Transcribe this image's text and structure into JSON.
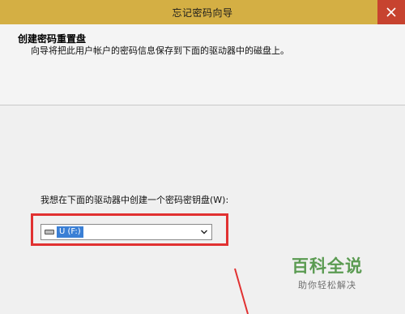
{
  "window": {
    "title": "忘记密码向导",
    "close_glyph": "close-icon"
  },
  "header": {
    "title": "创建密码重置盘",
    "description": "向导将把此用户帐户的密码信息保存到下面的驱动器中的磁盘上。"
  },
  "form": {
    "prompt": "我想在下面的驱动器中创建一个密码密钥盘(W):",
    "drive_select": {
      "selected": "U (F:)",
      "icon": "drive-icon"
    }
  },
  "annotation": {
    "highlight_color": "#e13131"
  },
  "watermark": {
    "main": "百科全说",
    "sub": "助你轻松解决"
  },
  "colors": {
    "titlebar": "#d4af44",
    "close_button": "#c7432f",
    "selection": "#3a7fd5",
    "watermark_green": "#5b9b52"
  }
}
